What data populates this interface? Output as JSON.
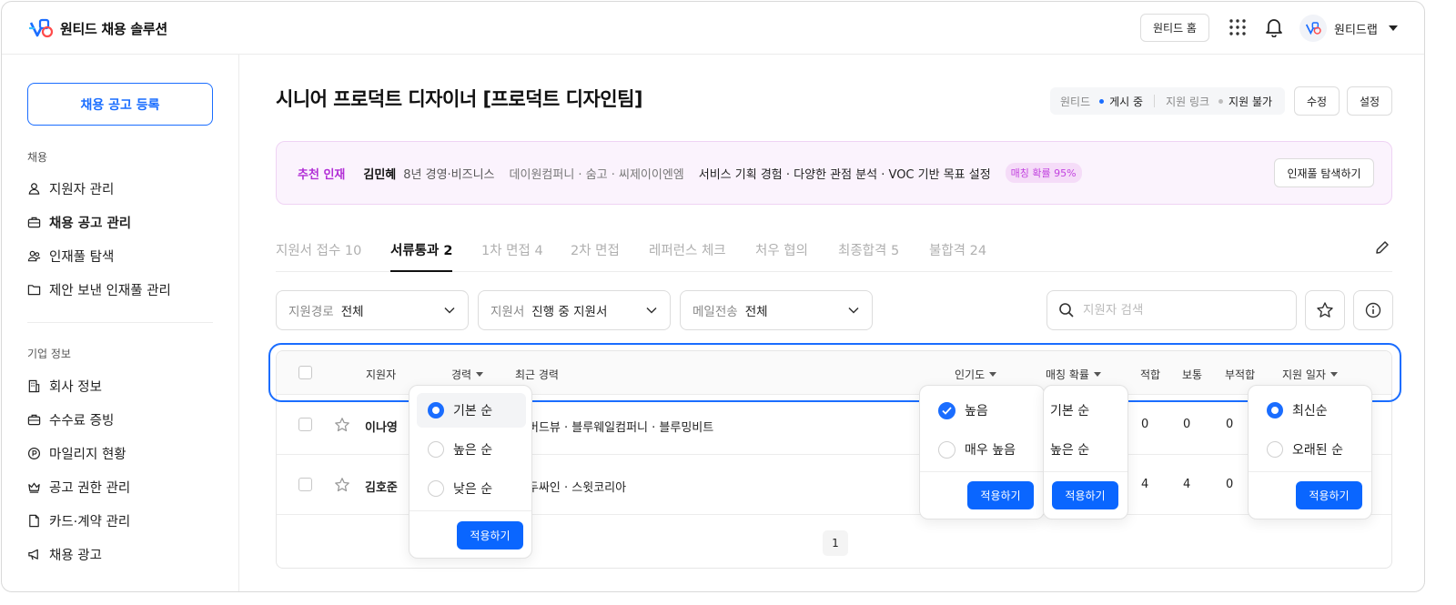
{
  "header": {
    "app_title": "원티드 채용 솔루션",
    "home_button": "원티드 홈",
    "company_name": "원티드랩"
  },
  "sidebar": {
    "register_button": "채용 공고 등록",
    "section_recruit": "채용",
    "recruit_items": [
      {
        "label": "지원자 관리",
        "icon": "person-icon"
      },
      {
        "label": "채용 공고 관리",
        "icon": "briefcase-icon"
      },
      {
        "label": "인재풀 탐색",
        "icon": "people-icon"
      },
      {
        "label": "제안 보낸 인재풀 관리",
        "icon": "folder-icon"
      }
    ],
    "section_company": "기업 정보",
    "company_items": [
      {
        "label": "회사 정보",
        "icon": "building-icon"
      },
      {
        "label": "수수료 증빙",
        "icon": "briefcase-icon"
      },
      {
        "label": "마일리지 현황",
        "icon": "coin-icon"
      },
      {
        "label": "공고 권한 관리",
        "icon": "crown-icon"
      },
      {
        "label": "카드·계약 관리",
        "icon": "document-icon"
      },
      {
        "label": "채용 광고",
        "icon": "megaphone-icon"
      }
    ]
  },
  "job": {
    "title": "시니어 프로덕트 디자이너 [프로덕트 디자인팀]",
    "status": {
      "wanted_label": "원티드",
      "wanted_value": "게시 중",
      "link_label": "지원 링크",
      "link_value": "지원 불가"
    },
    "edit_button": "수정",
    "settings_button": "설정"
  },
  "recommend": {
    "tag": "추천 인재",
    "name": "김민혜",
    "experience": "8년 경영·비즈니스",
    "companies": "데이원컴퍼니 · 숨고 · 씨제이이엔엠",
    "description": "서비스 기획 경험 · 다양한 관점 분석 · VOC 기반 목표 설정",
    "badge": "매칭 확률 95%",
    "pool_button": "인재풀 탐색하기"
  },
  "tabs": [
    "지원서 접수 10",
    "서류통과 2",
    "1차 면접 4",
    "2차 면접",
    "레퍼런스 체크",
    "처우 협의",
    "최종합격 5",
    "불합격 24"
  ],
  "filters": [
    {
      "label": "지원경로",
      "value": "전체"
    },
    {
      "label": "지원서",
      "value": "진행 중 지원서"
    },
    {
      "label": "메일전송",
      "value": "전체"
    }
  ],
  "search": {
    "placeholder": "지원자 검색"
  },
  "table": {
    "headers": {
      "applicant": "지원자",
      "career": "경력",
      "recent": "최근 경력",
      "popularity": "인기도",
      "matching": "매칭 확률",
      "fit": "적합",
      "normal": "보통",
      "unfit": "부적합",
      "date": "지원 일자"
    },
    "rows": [
      {
        "name": "이나영",
        "recent": "버드뷰 · 블루웨일컴퍼니 · 블루밍비트",
        "fit": "0",
        "normal": "0",
        "unfit": "0"
      },
      {
        "name": "김호준",
        "recent": "두싸인 · 스윗코리아",
        "fit": "4",
        "normal": "4",
        "unfit": "0"
      }
    ],
    "page": "1"
  },
  "dropdowns": {
    "career": {
      "options": [
        "기본 순",
        "높은 순",
        "낮은 순"
      ],
      "selected": "기본 순",
      "apply": "적용하기"
    },
    "popularity": {
      "options": [
        "높음",
        "매우 높음"
      ],
      "checked": [
        "높음"
      ],
      "apply": "적용하기"
    },
    "matching": {
      "options": [
        "기본 순",
        "높은 순"
      ],
      "apply": "적용하기"
    },
    "date": {
      "options": [
        "최신순",
        "오래된 순"
      ],
      "selected": "최신순",
      "apply": "적용하기"
    }
  },
  "colors": {
    "accent": "#1a6dff",
    "recommend_tag": "#b22fd6",
    "recommend_bg": "#fbf3fd"
  }
}
